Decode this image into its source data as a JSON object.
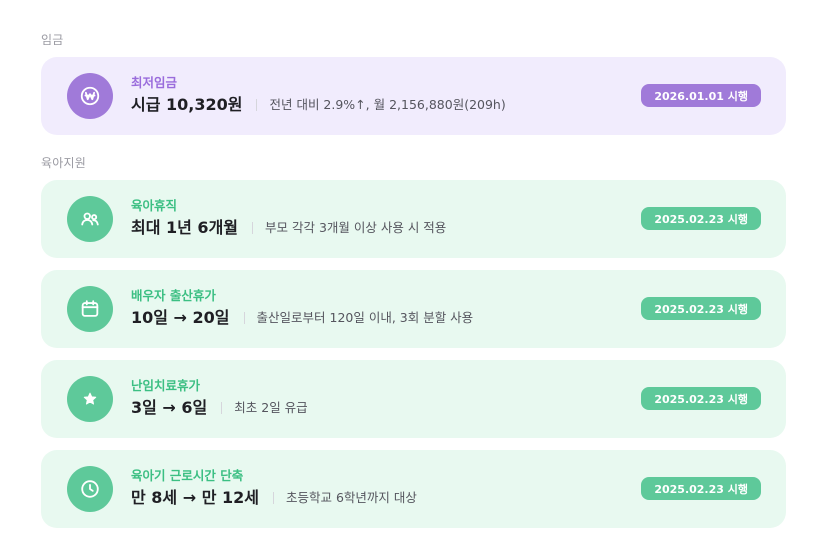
{
  "sections": {
    "wage": "임금",
    "childcare": "육아지원"
  },
  "cards": [
    {
      "icon": "won-icon",
      "label": "최저임금",
      "headline": "시급 10,320원",
      "description": "전년 대비 2.9%↑, 월 2,156,880원(209h)",
      "badge": "2026.01.01 시행"
    },
    {
      "icon": "people-icon",
      "label": "육아휴직",
      "headline": "최대 1년 6개월",
      "description": "부모 각각 3개월 이상 사용 시 적용",
      "badge": "2025.02.23 시행"
    },
    {
      "icon": "calendar-icon",
      "label": "배우자 출산휴가",
      "headline": "10일 → 20일",
      "description": "출산일로부터 120일 이내, 3회 분할 사용",
      "badge": "2025.02.23 시행"
    },
    {
      "icon": "star-icon",
      "label": "난임치료휴가",
      "headline": "3일 → 6일",
      "description": "최초 2일 유급",
      "badge": "2025.02.23 시행"
    },
    {
      "icon": "clock-icon",
      "label": "육아기 근로시간 단축",
      "headline": "만 8세 → 만 12세",
      "description": "초등학교 6학년까지 대상",
      "badge": "2025.02.23 시행"
    }
  ],
  "colors": {
    "purple_accent": "#a07ad9",
    "purple_bg": "#f1ecfd",
    "green_accent": "#5ec99a",
    "green_bg": "#e8f9f0"
  }
}
